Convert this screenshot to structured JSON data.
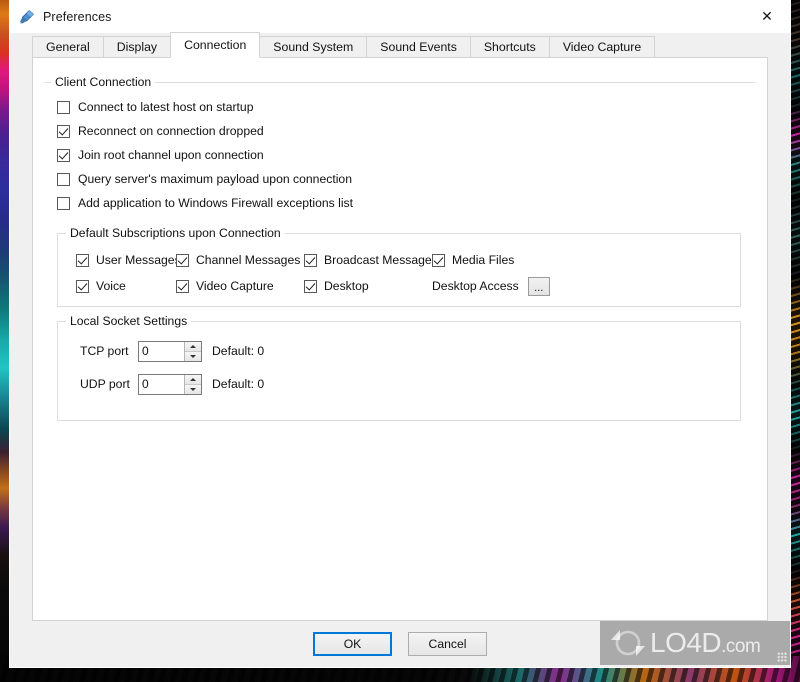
{
  "window": {
    "title": "Preferences",
    "icon": "app-icon",
    "close_label": "✕"
  },
  "tabs": [
    {
      "label": "General",
      "active": false
    },
    {
      "label": "Display",
      "active": false
    },
    {
      "label": "Connection",
      "active": true
    },
    {
      "label": "Sound System",
      "active": false
    },
    {
      "label": "Sound Events",
      "active": false
    },
    {
      "label": "Shortcuts",
      "active": false
    },
    {
      "label": "Video Capture",
      "active": false
    }
  ],
  "client_connection": {
    "title": "Client Connection",
    "options": [
      {
        "label": "Connect to latest host on startup",
        "checked": false
      },
      {
        "label": "Reconnect on connection dropped",
        "checked": true
      },
      {
        "label": "Join root channel upon connection",
        "checked": true
      },
      {
        "label": "Query server's maximum payload upon connection",
        "checked": false
      },
      {
        "label": "Add application to Windows Firewall exceptions list",
        "checked": false
      }
    ]
  },
  "subscriptions": {
    "title": "Default Subscriptions upon Connection",
    "items": [
      {
        "label": "User Messages",
        "checked": true
      },
      {
        "label": "Channel Messages",
        "checked": true
      },
      {
        "label": "Broadcast Messages",
        "checked": true
      },
      {
        "label": "Media Files",
        "checked": true
      },
      {
        "label": "Voice",
        "checked": true
      },
      {
        "label": "Video Capture",
        "checked": true
      },
      {
        "label": "Desktop",
        "checked": true
      }
    ],
    "desktop_access_label": "Desktop Access",
    "desktop_access_button": "..."
  },
  "socket_settings": {
    "title": "Local Socket Settings",
    "ports": [
      {
        "label": "TCP port",
        "value": "0",
        "default_text": "Default: 0"
      },
      {
        "label": "UDP port",
        "value": "0",
        "default_text": "Default: 0"
      }
    ]
  },
  "footer": {
    "ok_label": "OK",
    "cancel_label": "Cancel"
  },
  "watermark": {
    "name": "LO4D",
    "domain": ".com"
  }
}
